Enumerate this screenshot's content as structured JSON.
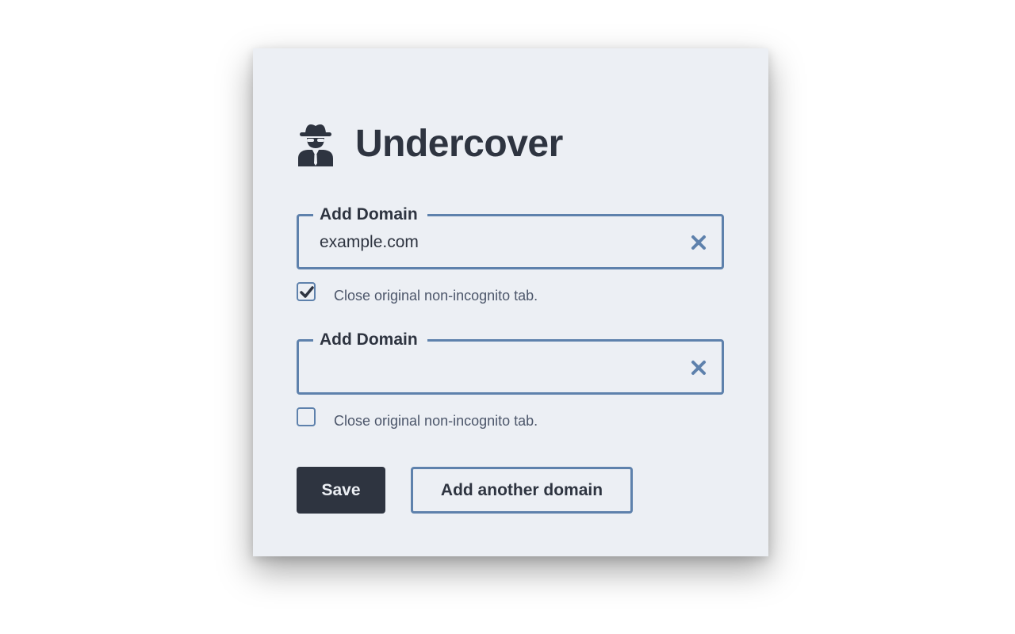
{
  "app": {
    "title": "Undercover",
    "logo_icon": "incognito-spy-icon"
  },
  "colors": {
    "background": "#eceff4",
    "text": "#2e3440",
    "accent": "#5e81ac",
    "muted_text": "#4c566a"
  },
  "domains": [
    {
      "legend": "Add Domain",
      "value": "example.com",
      "placeholder": "",
      "clear_icon": "close-x-icon",
      "checkbox_label": "Close original non-incognito tab.",
      "checked": true
    },
    {
      "legend": "Add Domain",
      "value": "",
      "placeholder": "",
      "clear_icon": "close-x-icon",
      "checkbox_label": "Close original non-incognito tab.",
      "checked": false
    }
  ],
  "actions": {
    "save_label": "Save",
    "add_label": "Add another domain"
  }
}
